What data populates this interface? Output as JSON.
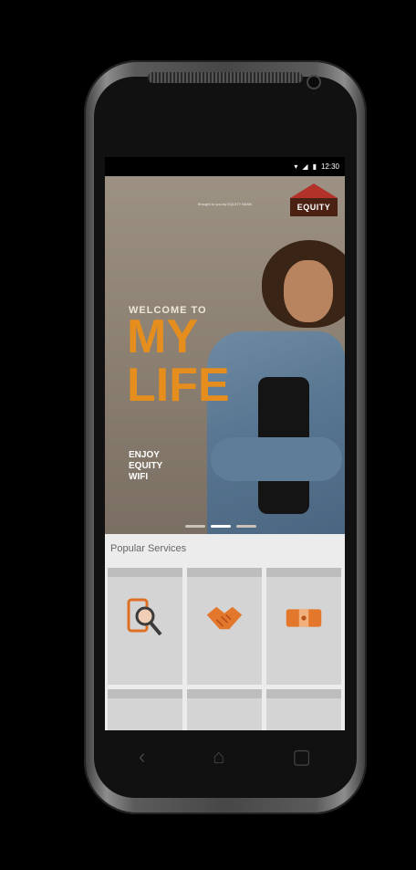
{
  "status": {
    "time": "12:30"
  },
  "brand": {
    "tagline": "Brought to you by EQUITY BANK",
    "logo_text": "EQUITY",
    "logo_color": "#4b2114",
    "roof_color": "#b2322a"
  },
  "hero": {
    "welcome": "WELCOME TO",
    "title_line1": "MY",
    "title_line2": "LIFE",
    "enjoy_line1": "ENJOY",
    "enjoy_line2": "EQUITY",
    "enjoy_line3": "WIFI",
    "accent_color": "#e58e1e"
  },
  "services": {
    "heading": "Popular Services",
    "tiles": [
      {
        "icon": "phone-search-icon"
      },
      {
        "icon": "handshake-icon"
      },
      {
        "icon": "wallet-icon"
      },
      {
        "icon": "tile-4-icon"
      },
      {
        "icon": "tile-5-icon"
      },
      {
        "icon": "tile-6-icon"
      }
    ]
  },
  "nav": {
    "back": "‹",
    "home": "⌂",
    "recents": "▢"
  }
}
